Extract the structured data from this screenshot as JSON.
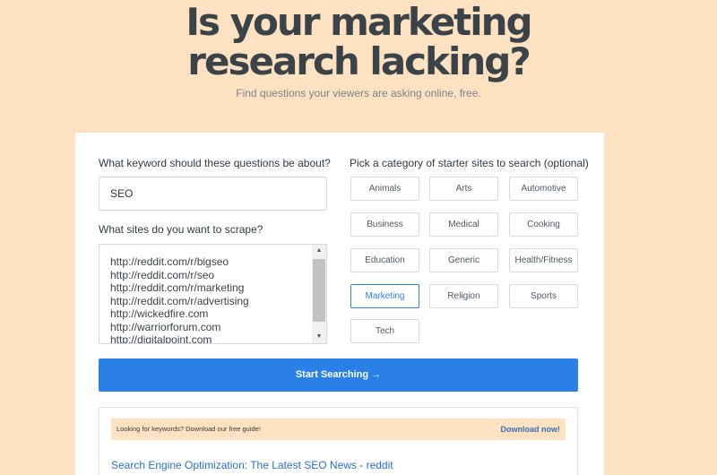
{
  "hero": {
    "headline_line1": "Is your marketing",
    "headline_line2": "research lacking?",
    "subtitle": "Find questions your viewers are asking online, free."
  },
  "form": {
    "keyword_label": "What keyword should these questions be about?",
    "keyword_value": "SEO",
    "sites_label": "What sites do you want to scrape?",
    "sites_value": "http://reddit.com/r/bigseo\nhttp://reddit.com/r/seo\nhttp://reddit.com/r/marketing\nhttp://reddit.com/r/advertising\nhttp://wickedfire.com\nhttp://warriorforum.com\nhttp://digitalpoint.com",
    "category_label": "Pick a category of starter sites to search (optional)",
    "categories": [
      "Animals",
      "Arts",
      "Automotive",
      "Business",
      "Medical",
      "Cooking",
      "Education",
      "Generic",
      "Health/Fitness",
      "Marketing",
      "Religion",
      "Sports",
      "Tech"
    ],
    "selected_category": "Marketing",
    "start_button": "Start Searching →"
  },
  "results": {
    "banner_text": "Looking for keywords? Download our free guide!",
    "banner_link": "Download now!",
    "first_result": "Search Engine Optimization: The Latest SEO News - reddit"
  },
  "colors": {
    "background": "#fde2c2",
    "accent": "#2b80e8",
    "link": "#2b6fc9"
  }
}
